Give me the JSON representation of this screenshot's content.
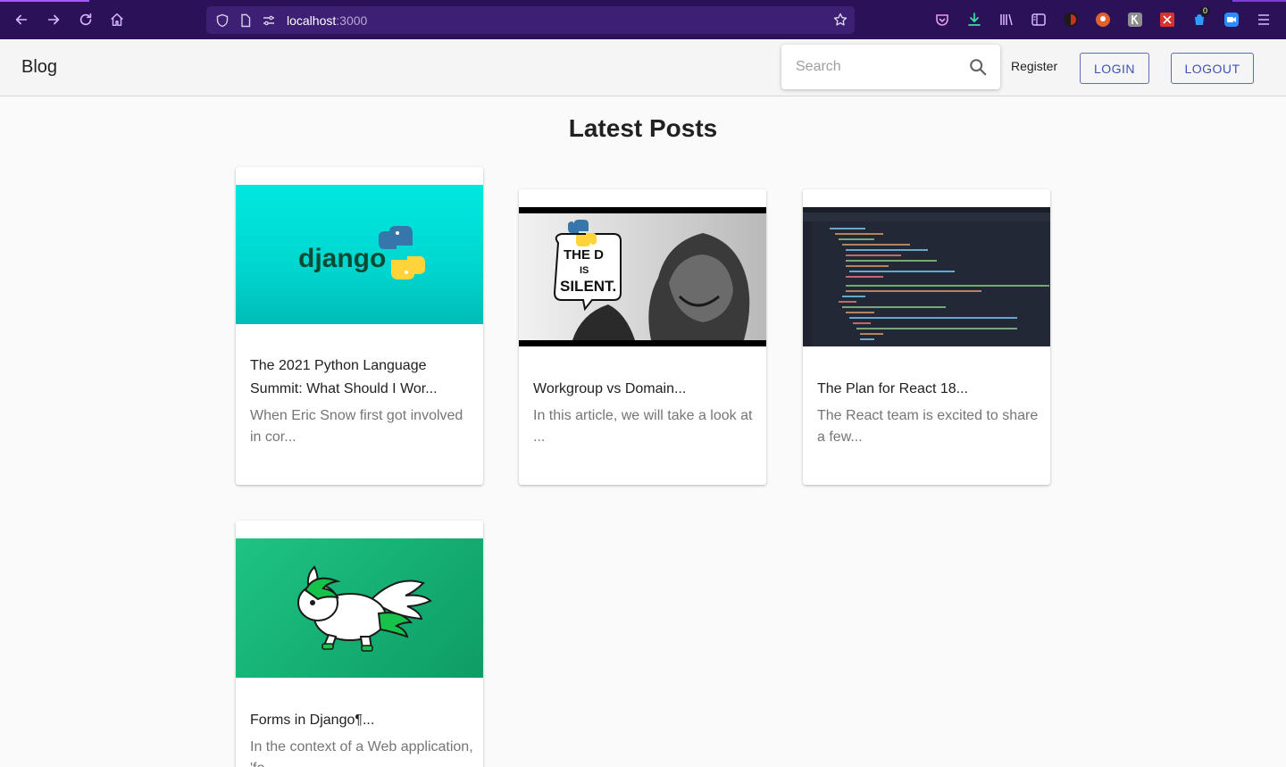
{
  "browser": {
    "url_host": "localhost",
    "url_port": ":3000",
    "badge_count": "0"
  },
  "header": {
    "brand": "Blog",
    "search_placeholder": "Search",
    "register_label": "Register",
    "login_label": "LOGIN",
    "logout_label": "LOGOUT"
  },
  "main": {
    "title": "Latest Posts",
    "posts": [
      {
        "title": "The 2021 Python Language Summit: What Should I Wor...",
        "excerpt": "When Eric Snow first got involved in cor...",
        "image_alt": "django-python-logo"
      },
      {
        "title": "Workgroup vs Domain...",
        "excerpt": "In this article, we will take a look at ...",
        "image_alt": "the-d-is-silent-comic",
        "image_text": [
          "THE D",
          "IS",
          "SILENT."
        ]
      },
      {
        "title": "The Plan for React 18...",
        "excerpt": "The React team is excited to share a few...",
        "image_alt": "code-editor-screenshot"
      },
      {
        "title": "Forms in Django¶...",
        "excerpt": "In the context of a Web application, 'fo...",
        "image_alt": "django-pony-mascot"
      }
    ]
  },
  "colors": {
    "browser_bar": "#2b1158",
    "accent": "#3f51b5",
    "header_bg": "#f5f5f5",
    "page_bg": "#fafafa"
  }
}
